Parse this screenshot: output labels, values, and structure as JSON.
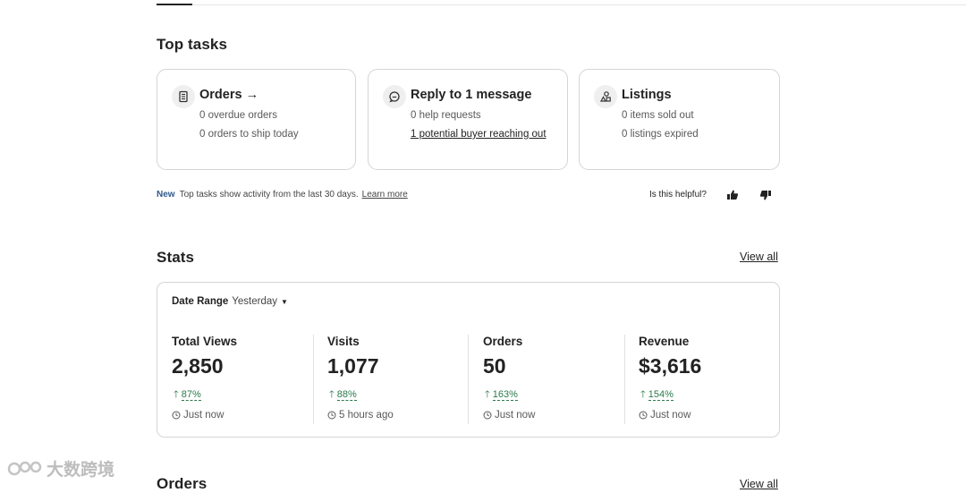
{
  "top_tasks": {
    "title": "Top tasks",
    "cards": [
      {
        "icon": "receipt-icon",
        "title": "Orders",
        "arrow": "→",
        "lines": [
          "0 overdue orders",
          "0 orders to ship today"
        ]
      },
      {
        "icon": "message-icon",
        "title": "Reply to 1 message",
        "lines": [
          "0 help requests"
        ],
        "link": "1 potential buyer reaching out"
      },
      {
        "icon": "shapes-icon",
        "title": "Listings",
        "lines": [
          "0 items sold out",
          "0 listings expired"
        ]
      }
    ],
    "note_badge": "New",
    "note_text": "Top tasks show activity from the last 30 days.",
    "note_link": "Learn more",
    "helpful_text": "Is this helpful?"
  },
  "stats": {
    "title": "Stats",
    "view_all": "View all",
    "date_range_label": "Date Range",
    "date_range_value": "Yesterday",
    "items": [
      {
        "label": "Total Views",
        "value": "2,850",
        "change": "87%",
        "time": "Just now"
      },
      {
        "label": "Visits",
        "value": "1,077",
        "change": "88%",
        "time": "5 hours ago"
      },
      {
        "label": "Orders",
        "value": "50",
        "change": "163%",
        "time": "Just now"
      },
      {
        "label": "Revenue",
        "value": "$3,616",
        "change": "154%",
        "time": "Just now"
      }
    ],
    "change_color": "#2a7a4b"
  },
  "orders": {
    "title": "Orders",
    "view_all": "View all"
  },
  "watermark": {
    "text": "大数跨境"
  }
}
